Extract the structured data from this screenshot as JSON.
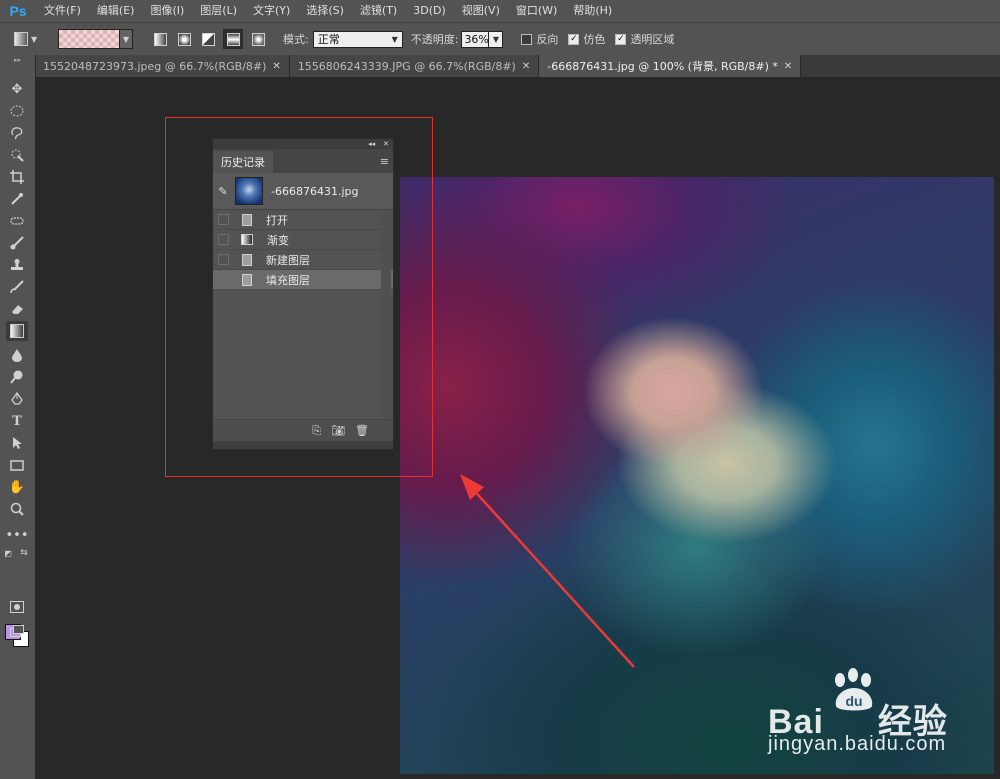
{
  "app": {
    "logo": "Ps"
  },
  "menu": [
    "文件(F)",
    "编辑(E)",
    "图像(I)",
    "图层(L)",
    "文字(Y)",
    "选择(S)",
    "滤镜(T)",
    "3D(D)",
    "视图(V)",
    "窗口(W)",
    "帮助(H)"
  ],
  "options": {
    "mode_label": "模式:",
    "mode_value": "正常",
    "opacity_label": "不透明度:",
    "opacity_value": "36%",
    "reverse_label": "反向",
    "dither_label": "仿色",
    "transparency_label": "透明区域",
    "reverse_checked": false,
    "dither_checked": true,
    "transparency_checked": true
  },
  "tabs": [
    {
      "label": "1552048723973.jpeg @ 66.7%(RGB/8#)",
      "active": false
    },
    {
      "label": "1556806243339.JPG @ 66.7%(RGB/8#)",
      "active": false
    },
    {
      "label": "-666876431.jpg @ 100% (背景, RGB/8#) *",
      "active": true
    }
  ],
  "colors": {
    "foreground": "#b695e8",
    "background": "#ffffff",
    "highlight": "#e0322f"
  },
  "history_panel": {
    "title": "历史记录",
    "snapshot_label": "-666876431.jpg",
    "items": [
      {
        "label": "打开",
        "icon": "document-icon"
      },
      {
        "label": "渐变",
        "icon": "gradient-icon"
      },
      {
        "label": "新建图层",
        "icon": "document-icon"
      },
      {
        "label": "填充图层",
        "icon": "document-icon",
        "selected": true
      }
    ]
  },
  "watermark": {
    "brand": "Bai",
    "brand_tail": "经验",
    "url": "jingyan.baidu.com"
  }
}
